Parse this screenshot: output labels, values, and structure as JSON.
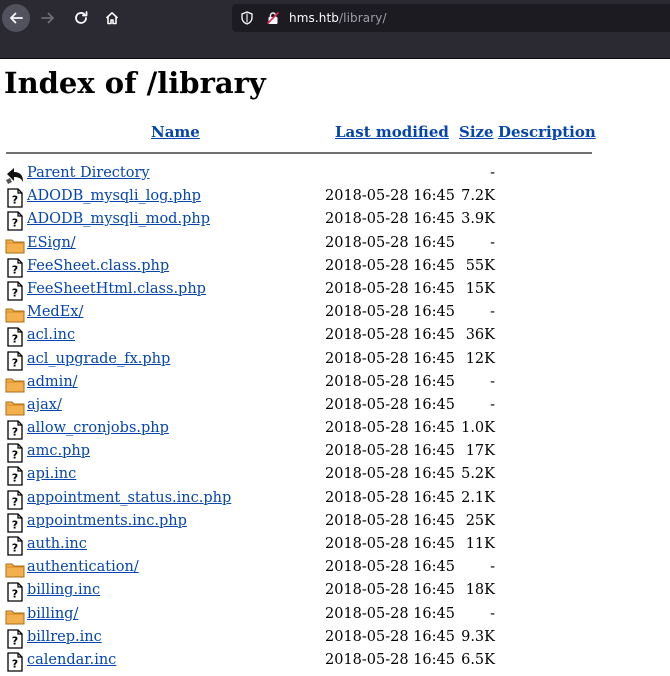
{
  "browser": {
    "url_host": "hms.htb",
    "url_path": "/library/"
  },
  "page": {
    "title": "Index of /library",
    "columns": {
      "name": "Name",
      "last_modified": "Last modified",
      "size": "Size",
      "description": "Description"
    },
    "entries": [
      {
        "type": "parent",
        "name": "Parent Directory",
        "date": "",
        "size": "-"
      },
      {
        "type": "file",
        "name": "ADODB_mysqli_log.php",
        "date": "2018-05-28 16:45",
        "size": "7.2K"
      },
      {
        "type": "file",
        "name": "ADODB_mysqli_mod.php",
        "date": "2018-05-28 16:45",
        "size": "3.9K"
      },
      {
        "type": "folder",
        "name": "ESign/",
        "date": "2018-05-28 16:45",
        "size": "-"
      },
      {
        "type": "file",
        "name": "FeeSheet.class.php",
        "date": "2018-05-28 16:45",
        "size": "55K"
      },
      {
        "type": "file",
        "name": "FeeSheetHtml.class.php",
        "date": "2018-05-28 16:45",
        "size": "15K"
      },
      {
        "type": "folder",
        "name": "MedEx/",
        "date": "2018-05-28 16:45",
        "size": "-"
      },
      {
        "type": "file",
        "name": "acl.inc",
        "date": "2018-05-28 16:45",
        "size": "36K"
      },
      {
        "type": "file",
        "name": "acl_upgrade_fx.php",
        "date": "2018-05-28 16:45",
        "size": "12K"
      },
      {
        "type": "folder",
        "name": "admin/",
        "date": "2018-05-28 16:45",
        "size": "-"
      },
      {
        "type": "folder",
        "name": "ajax/",
        "date": "2018-05-28 16:45",
        "size": "-"
      },
      {
        "type": "file",
        "name": "allow_cronjobs.php",
        "date": "2018-05-28 16:45",
        "size": "1.0K"
      },
      {
        "type": "file",
        "name": "amc.php",
        "date": "2018-05-28 16:45",
        "size": "17K"
      },
      {
        "type": "file",
        "name": "api.inc",
        "date": "2018-05-28 16:45",
        "size": "5.2K"
      },
      {
        "type": "file",
        "name": "appointment_status.inc.php",
        "date": "2018-05-28 16:45",
        "size": "2.1K"
      },
      {
        "type": "file",
        "name": "appointments.inc.php",
        "date": "2018-05-28 16:45",
        "size": "25K"
      },
      {
        "type": "file",
        "name": "auth.inc",
        "date": "2018-05-28 16:45",
        "size": "11K"
      },
      {
        "type": "folder",
        "name": "authentication/",
        "date": "2018-05-28 16:45",
        "size": "-"
      },
      {
        "type": "file",
        "name": "billing.inc",
        "date": "2018-05-28 16:45",
        "size": "18K"
      },
      {
        "type": "folder",
        "name": "billing/",
        "date": "2018-05-28 16:45",
        "size": "-"
      },
      {
        "type": "file",
        "name": "billrep.inc",
        "date": "2018-05-28 16:45",
        "size": "9.3K"
      },
      {
        "type": "file",
        "name": "calendar.inc",
        "date": "2018-05-28 16:45",
        "size": "6.5K"
      }
    ]
  }
}
